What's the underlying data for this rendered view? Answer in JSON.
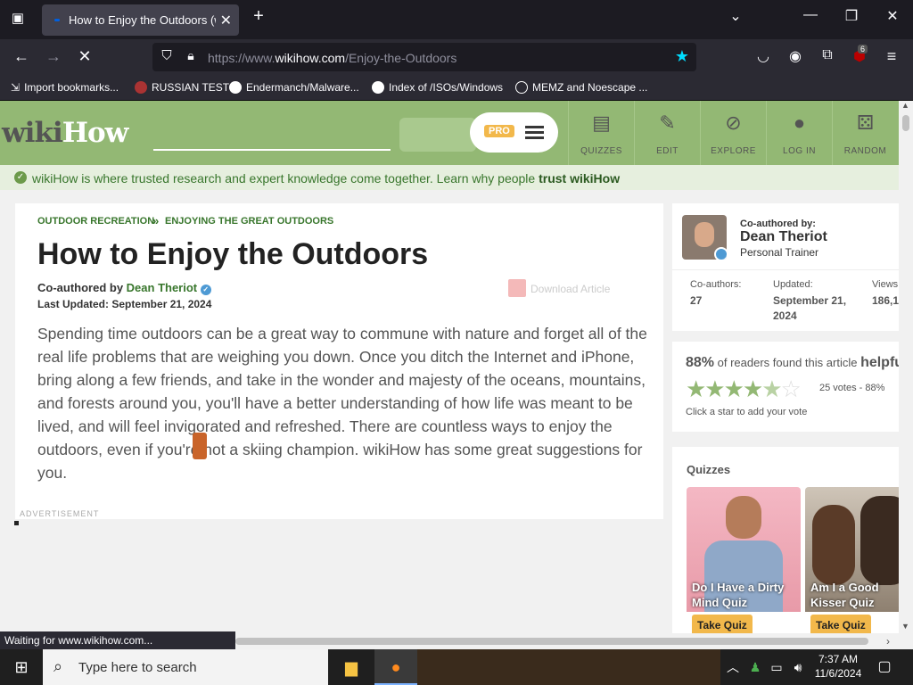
{
  "browser": {
    "tab_title": "How to Enjoy the Outdoors (wit",
    "url_prefix": "https://www.",
    "url_host": "wikihow.com",
    "url_path": "/Enjoy-the-Outdoors",
    "extension_badge": "6",
    "bookmarks": [
      {
        "label": "Import bookmarks..."
      },
      {
        "label": "RUSSIAN TEST"
      },
      {
        "label": "Endermanch/Malware..."
      },
      {
        "label": "Index of /ISOs/Windows"
      },
      {
        "label": "MEMZ and Noescape ..."
      }
    ],
    "status_text": "Waiting for www.wikihow.com..."
  },
  "site": {
    "logo_wiki": "wiki",
    "logo_how": "How",
    "pro_badge": "PRO",
    "nav": [
      {
        "label": "QUIZZES",
        "icon": "quizzes-icon"
      },
      {
        "label": "EDIT",
        "icon": "pencil-icon"
      },
      {
        "label": "EXPLORE",
        "icon": "compass-icon"
      },
      {
        "label": "LOG IN",
        "icon": "user-icon"
      },
      {
        "label": "RANDOM",
        "icon": "dice-icon"
      }
    ],
    "trust_text": "wikiHow is where trusted research and expert knowledge come together. Learn why people ",
    "trust_link": "trust wikiHow"
  },
  "article": {
    "breadcrumb_1": "OUTDOOR RECREATION",
    "breadcrumb_sep": "»",
    "breadcrumb_2": "ENJOYING THE GREAT OUTDOORS",
    "title": "How to Enjoy the Outdoors",
    "coauthored_prefix": "Co-authored by ",
    "author": "Dean Theriot",
    "last_updated": "Last Updated: September 21, 2024",
    "download": "Download Article",
    "intro": "Spending time outdoors can be a great way to commune with nature and forget all of the real life problems that are weighing you down. Once you ditch the Internet and iPhone, bring along a few friends, and take in the wonder and majesty of the oceans, mountains, and forests around you, you'll have a better understanding of how life was meant to be lived, and will feel invigorated and refreshed. There are countless ways to enjoy the outdoors, even if you're not a skiing champion. wikiHow has some great suggestions for you.",
    "advertisement": "ADVERTISEMENT"
  },
  "sidebar": {
    "coauthored_by": "Co-authored by:",
    "name": "Dean Theriot",
    "role": "Personal Trainer",
    "coauthors_label": "Co-authors:",
    "coauthors_value": "27",
    "updated_label": "Updated:",
    "updated_value_1": "September 21,",
    "updated_value_2": "2024",
    "views_label": "Views",
    "views_value": "186,1",
    "helpful_pct": "88%",
    "helpful_text": " of readers found this article ",
    "helpful_bold": "helpfu",
    "stars": "★★★★",
    "star_half": "★",
    "star_empty": "☆",
    "votes": "25 votes - 88%",
    "click_star": "Click a star to add your vote",
    "quizzes_title": "Quizzes",
    "quizzes": [
      {
        "title": "Do I Have a Dirty Mind Quiz",
        "button": "Take Quiz"
      },
      {
        "title": "Am I a Good Kisser Quiz",
        "button": "Take Quiz"
      }
    ]
  },
  "taskbar": {
    "search_placeholder": "Type here to search",
    "time": "7:37 AM",
    "date": "11/6/2024"
  }
}
